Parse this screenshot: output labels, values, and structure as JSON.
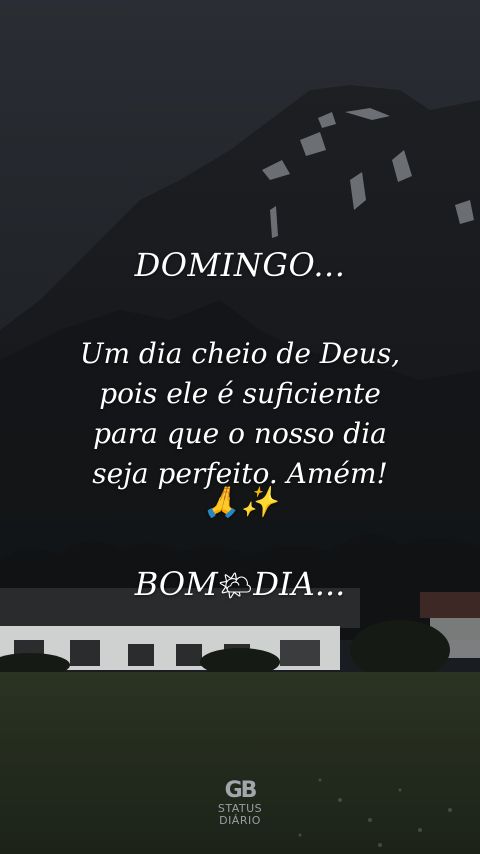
{
  "background": {
    "scene": "dark mountain with snow patches, farmhouse and grassy meadow under overcast sky",
    "colors": {
      "sky": "#2a2d33",
      "mountain": "#15171a",
      "snow": "#8e9297",
      "grass": "#2a3322"
    }
  },
  "message": {
    "heading": "DOMINGO...",
    "lines": [
      "Um dia cheio de Deus,",
      "pois ele é suficiente",
      "para que o nosso dia",
      "seja perfeito. Amém!"
    ],
    "emojis": "🙏✨",
    "greeting_start": "BOM",
    "greeting_emoji": "🌤",
    "greeting_end": "DIA..."
  },
  "watermark": {
    "mark": "GB",
    "line1": "STATUS",
    "line2": "DIÁRIO"
  }
}
